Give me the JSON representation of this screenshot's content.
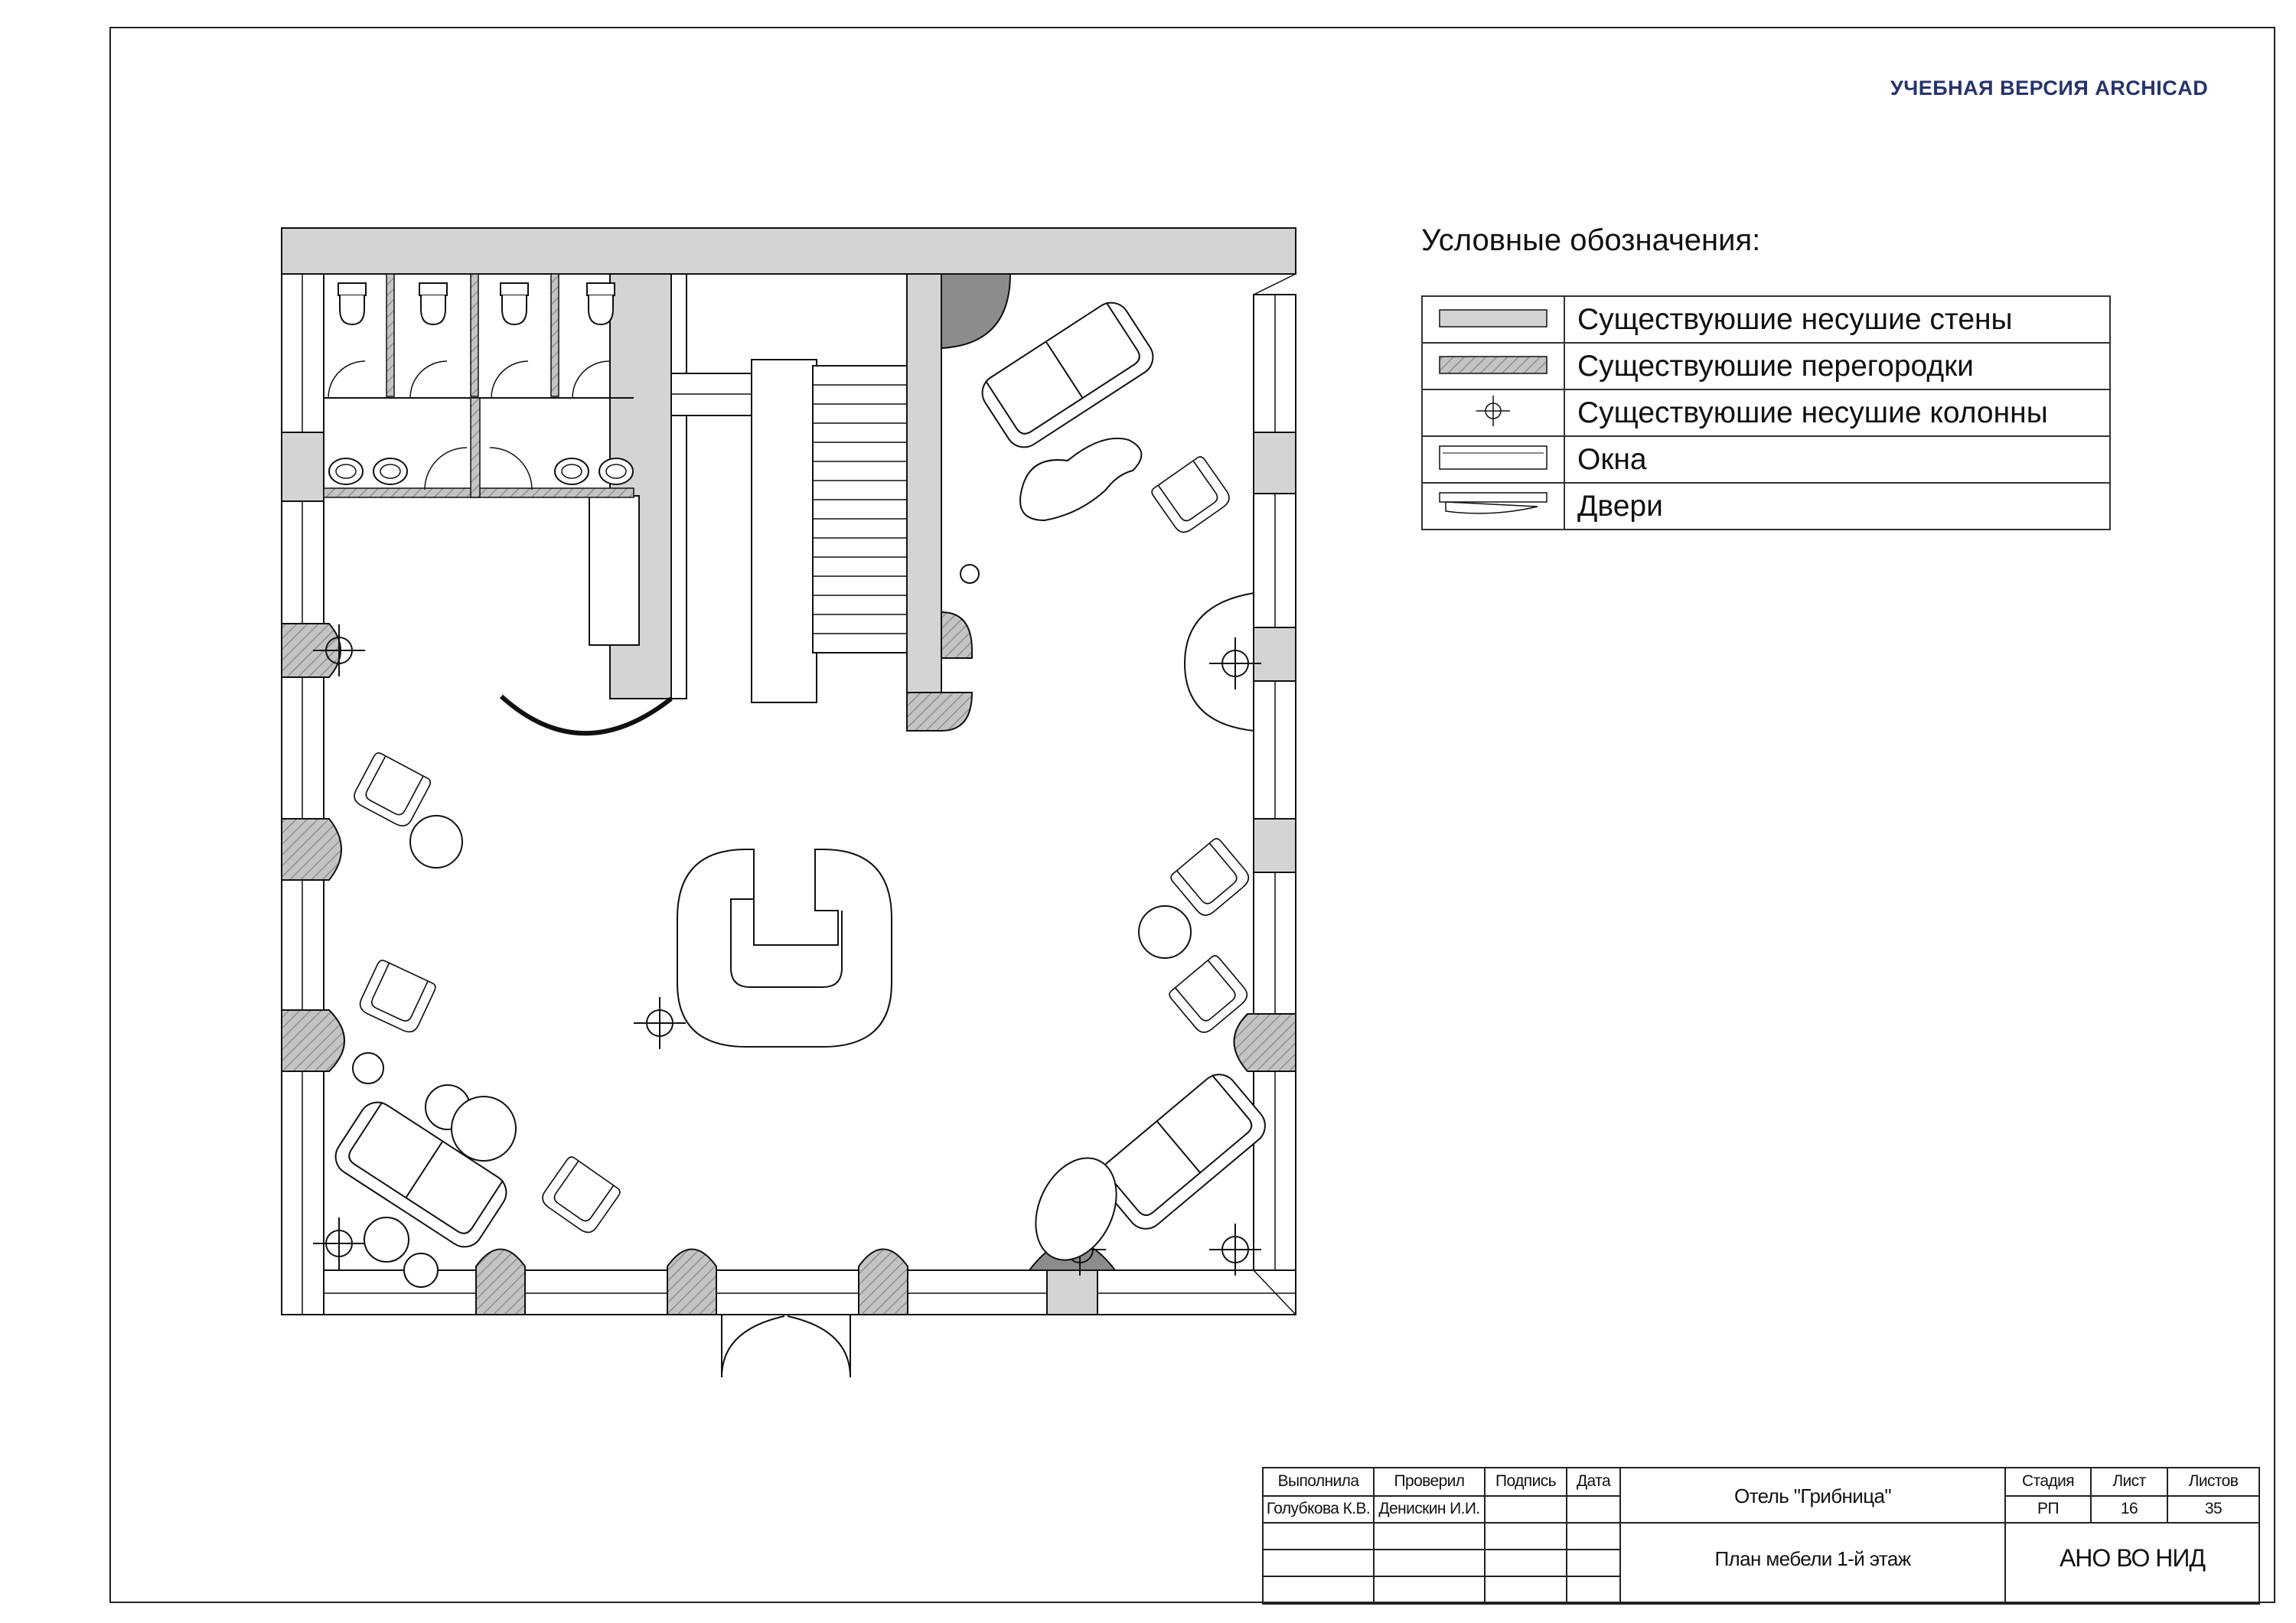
{
  "watermark": "УЧЕБНАЯ ВЕРСИЯ ARCHICAD",
  "legend": {
    "title": "Условные обозначения:",
    "items": [
      {
        "label": "Существуюшие несушие стены",
        "icon": "bearing-wall-swatch-icon"
      },
      {
        "label": "Существуюшие перегородки",
        "icon": "partition-hatch-swatch-icon"
      },
      {
        "label": "Существуюшие несушие колонны",
        "icon": "column-crosshair-icon"
      },
      {
        "label": "Окна",
        "icon": "window-symbol-icon"
      },
      {
        "label": "Двери",
        "icon": "door-symbol-icon"
      }
    ]
  },
  "colors": {
    "wall_fill": "#d4d4d4",
    "partition_fill": "#bdbdbd",
    "dark_fill": "#8c8c8c",
    "line": "#111111",
    "watermark": "#27336b"
  },
  "title_block": {
    "headers": {
      "performed": "Выполнила",
      "checked": "Проверил",
      "signature": "Подпись",
      "date": "Дата"
    },
    "performer": "Голубкова К.В.",
    "checker": "Денискин И.И.",
    "project": "Отель \"Грибница\"",
    "sheet_title": "План мебели 1-й этаж",
    "stage_header": "Стадия",
    "sheet_header": "Лист",
    "sheets_header": "Листов",
    "stage": "РП",
    "sheet_number": "16",
    "sheets_total": "35",
    "organization": "АНО ВО НИД"
  }
}
